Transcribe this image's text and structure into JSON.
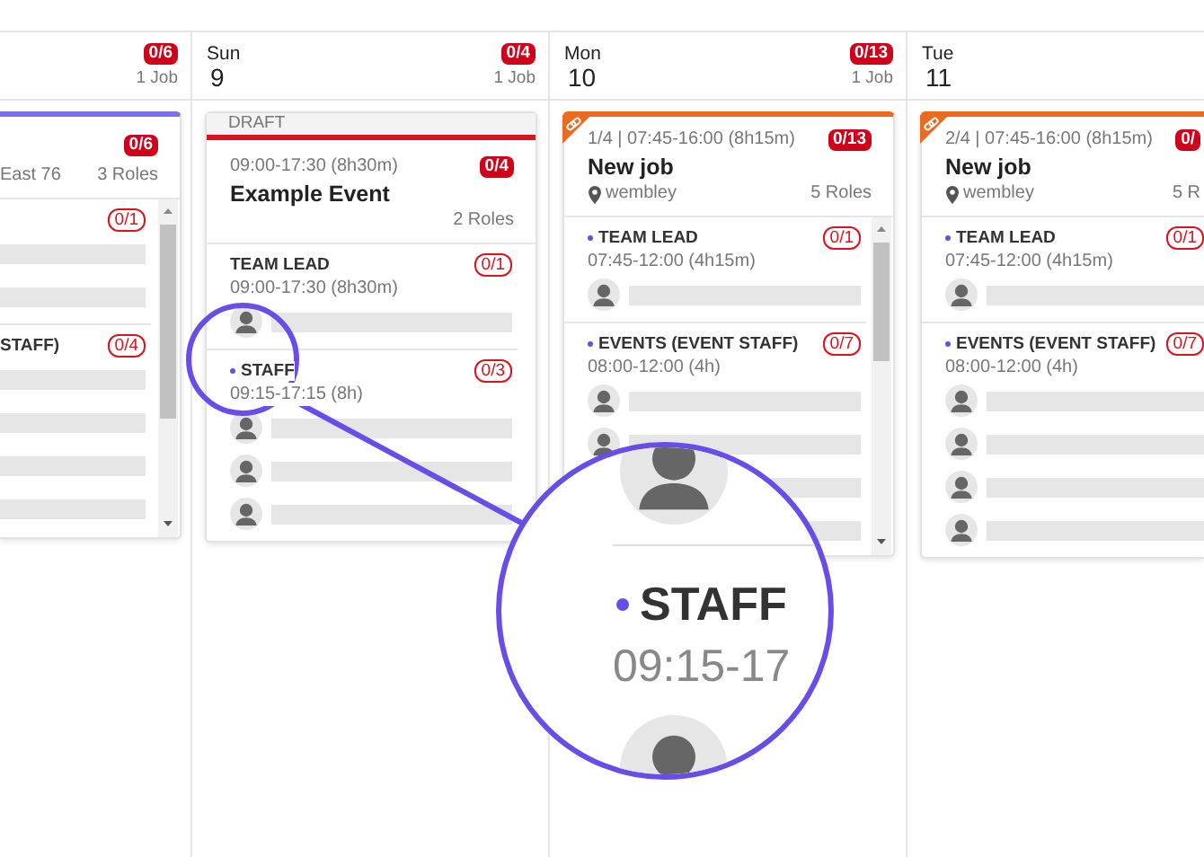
{
  "columns": [
    {
      "badge": "0/6",
      "jobs": "1 Job",
      "cards": [
        {
          "kind": "single",
          "badge": "0/6",
          "location": "East 76",
          "roles_count": "3 Roles",
          "scroll": true,
          "roles": [
            {
              "badge": "0/1",
              "dot": false,
              "slots": [
                {
                  "kind": "bar"
                },
                {
                  "kind": "bar"
                }
              ]
            },
            {
              "label": "STAFF)",
              "badge": "0/4",
              "dot": false,
              "slots": [
                {
                  "kind": "bar"
                },
                {
                  "kind": "bar"
                },
                {
                  "kind": "bar"
                },
                {
                  "kind": "bar"
                }
              ]
            }
          ]
        }
      ]
    },
    {
      "day": "Sun",
      "date": "9",
      "badge": "0/4",
      "jobs": "1 Job",
      "cards": [
        {
          "kind": "draft",
          "status": "DRAFT",
          "meta": "09:00-17:30 (8h30m)",
          "badge": "0/4",
          "title": "Example Event",
          "roles_count": "2 Roles",
          "scroll": false,
          "roles": [
            {
              "label": "TEAM LEAD",
              "badge": "0/1",
              "dot": false,
              "time": "09:00-17:30 (8h30m)",
              "slots": [
                {
                  "kind": "person"
                }
              ]
            },
            {
              "label": "STAFF",
              "badge": "0/3",
              "dot": true,
              "time": "09:15-17:15 (8h)",
              "slots": [
                {
                  "kind": "person"
                },
                {
                  "kind": "person"
                },
                {
                  "kind": "person"
                }
              ]
            }
          ]
        }
      ]
    },
    {
      "day": "Mon",
      "date": "10",
      "badge": "0/13",
      "jobs": "1 Job",
      "cards": [
        {
          "kind": "series",
          "meta": "1/4 | 07:45-16:00 (8h15m)",
          "badge": "0/13",
          "title": "New job",
          "location": "wembley",
          "roles_count": "5 Roles",
          "scroll": true,
          "roles": [
            {
              "label": "TEAM LEAD",
              "badge": "0/1",
              "dot": true,
              "time": "07:45-12:00 (4h15m)",
              "slots": [
                {
                  "kind": "person"
                }
              ]
            },
            {
              "label": "EVENTS (EVENT STAFF)",
              "badge": "0/7",
              "dot": true,
              "time": "08:00-12:00 (4h)",
              "slots": [
                {
                  "kind": "person"
                },
                {
                  "kind": "person"
                },
                {
                  "kind": "bar"
                },
                {
                  "kind": "bar"
                }
              ]
            }
          ]
        }
      ]
    },
    {
      "day": "Tue",
      "date": "11",
      "cards": [
        {
          "kind": "series",
          "meta": "2/4 | 07:45-16:00 (8h15m)",
          "badge": "0/",
          "title": "New job",
          "location": "wembley",
          "roles_count": "5 R",
          "scroll": false,
          "roles": [
            {
              "label": "TEAM LEAD",
              "badge": "0/1",
              "dot": true,
              "time": "07:45-12:00 (4h15m)",
              "slots": [
                {
                  "kind": "person"
                }
              ]
            },
            {
              "label": "EVENTS (EVENT STAFF)",
              "badge": "0/7",
              "dot": true,
              "time": "08:00-12:00 (4h)",
              "slots": [
                {
                  "kind": "person"
                },
                {
                  "kind": "person"
                },
                {
                  "kind": "person"
                },
                {
                  "kind": "person"
                }
              ]
            }
          ]
        }
      ]
    }
  ],
  "magnifier": {
    "label": "STAFF",
    "time": "09:15-17"
  }
}
